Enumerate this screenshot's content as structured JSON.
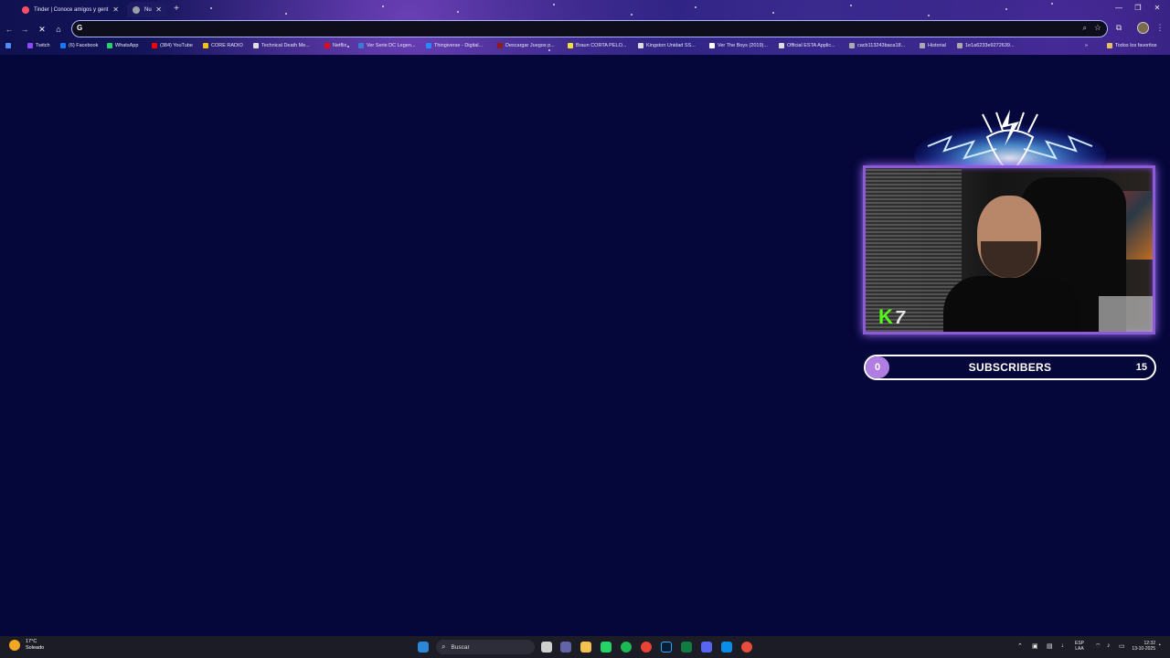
{
  "browser": {
    "tabs": [
      {
        "title": "Tinder | Conoce amigos y gent",
        "active": false,
        "favicon_color": "#fd5068"
      },
      {
        "title": "Nu",
        "active": true,
        "favicon_color": "#9aa0a6"
      }
    ],
    "omnibox": {
      "value": "",
      "placeholder": ""
    },
    "bookmarks": [
      {
        "label": "Twitch",
        "icon_color": "#9146ff"
      },
      {
        "label": "(6) Facebook",
        "icon_color": "#1877f2"
      },
      {
        "label": "WhatsApp",
        "icon_color": "#25d366"
      },
      {
        "label": "(384) YouTube",
        "icon_color": "#ff0000"
      },
      {
        "label": "CORE RADIO",
        "icon_color": "#f1c40f"
      },
      {
        "label": "Technical Death Me...",
        "icon_color": "#dddddd"
      },
      {
        "label": "Netflix",
        "icon_color": "#e50914"
      },
      {
        "label": "Ver Serie DC Legen...",
        "icon_color": "#3a7bd5"
      },
      {
        "label": "Thingiverse - Digital...",
        "icon_color": "#248bfb"
      },
      {
        "label": "Descargar Juegos p...",
        "icon_color": "#8e1a1a"
      },
      {
        "label": "Braun CORTA PELO...",
        "icon_color": "#f0e130"
      },
      {
        "label": "Kingston Unidad SS...",
        "icon_color": "#dddddd"
      },
      {
        "label": "Ver The Boys (2019)...",
        "icon_color": "#ffffff"
      },
      {
        "label": "Official ESTA Applic...",
        "icon_color": "#dddddd"
      },
      {
        "label": "cacb113243baca18...",
        "icon_color": "#aaaaaa"
      },
      {
        "label": "Historial",
        "icon_color": "#aaaaaa"
      },
      {
        "label": "1e1a6233e9272639...",
        "icon_color": "#aaaaaa"
      }
    ],
    "all_favorites": "Todos los favoritos"
  },
  "overlay": {
    "kick_badge": {
      "letter": "K",
      "number": "7"
    },
    "subscribers": {
      "label": "SUBSCRIBERS",
      "current": "0",
      "goal": "15",
      "progress": 0.0
    },
    "accent_color": "#8e5bd6",
    "kick_color": "#53fc18"
  },
  "taskbar": {
    "weather": {
      "temp": "17°C",
      "condition": "Soleado"
    },
    "search_label": "Buscar",
    "language": {
      "code": "ESP",
      "layout": "LAA"
    },
    "clock": {
      "time": "12:32",
      "date": "13-10-2025"
    },
    "pinned": [
      "windows-start",
      "search",
      "widgets",
      "task-view",
      "teams-chat",
      "file-explorer",
      "whatsapp",
      "spotify",
      "chrome",
      "photoshop",
      "excel",
      "discord",
      "edge",
      "app-red"
    ]
  }
}
